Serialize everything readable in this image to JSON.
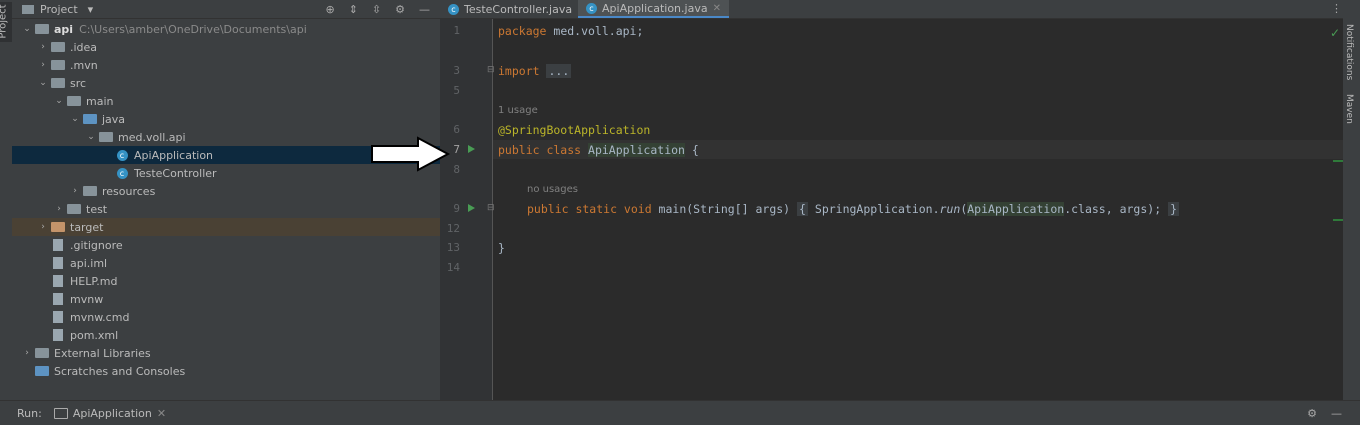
{
  "sidebar_tabs": {
    "project": "Project",
    "notifications": "Notifications",
    "maven": "Maven"
  },
  "project_panel": {
    "title": "Project",
    "tree": [
      {
        "label": "api",
        "path": "C:\\Users\\amber\\OneDrive\\Documents\\api",
        "depth": 0,
        "expanded": true,
        "icon": "folder"
      },
      {
        "label": ".idea",
        "depth": 1,
        "expanded": false,
        "icon": "folder"
      },
      {
        "label": ".mvn",
        "depth": 1,
        "expanded": false,
        "icon": "folder"
      },
      {
        "label": "src",
        "depth": 1,
        "expanded": true,
        "icon": "folder"
      },
      {
        "label": "main",
        "depth": 2,
        "expanded": true,
        "icon": "folder"
      },
      {
        "label": "java",
        "depth": 3,
        "expanded": true,
        "icon": "folder-blue"
      },
      {
        "label": "med.voll.api",
        "depth": 4,
        "expanded": true,
        "icon": "package"
      },
      {
        "label": "ApiApplication",
        "depth": 5,
        "icon": "java-class",
        "selected": true
      },
      {
        "label": "TesteController",
        "depth": 5,
        "icon": "java-class"
      },
      {
        "label": "resources",
        "depth": 3,
        "expanded": false,
        "icon": "folder"
      },
      {
        "label": "test",
        "depth": 2,
        "expanded": false,
        "icon": "folder"
      },
      {
        "label": "target",
        "depth": 1,
        "expanded": false,
        "icon": "folder-orange",
        "excluded": true
      },
      {
        "label": ".gitignore",
        "depth": 1,
        "icon": "file"
      },
      {
        "label": "api.iml",
        "depth": 1,
        "icon": "file"
      },
      {
        "label": "HELP.md",
        "depth": 1,
        "icon": "file"
      },
      {
        "label": "mvnw",
        "depth": 1,
        "icon": "file"
      },
      {
        "label": "mvnw.cmd",
        "depth": 1,
        "icon": "file"
      },
      {
        "label": "pom.xml",
        "depth": 1,
        "icon": "maven-file"
      },
      {
        "label": "External Libraries",
        "depth": 0,
        "expanded": false,
        "icon": "libraries"
      },
      {
        "label": "Scratches and Consoles",
        "depth": 0,
        "icon": "scratches"
      }
    ]
  },
  "editor_tabs": [
    {
      "label": "TesteController.java",
      "active": false
    },
    {
      "label": "ApiApplication.java",
      "active": true
    }
  ],
  "gutter": {
    "line_numbers": [
      "1",
      "3",
      "5",
      "6",
      "7",
      "8",
      "9",
      "12",
      "13",
      "14"
    ]
  },
  "code": {
    "package_kw": "package",
    "package_rest": " med.voll.api;",
    "import_kw": "import",
    "import_fold": "...",
    "usage_hint": "1 usage",
    "annotation": "@SpringBootApplication",
    "class_kw": "public class",
    "class_name": "ApiApplication",
    "class_brace": " {",
    "no_usages": "no usages",
    "main_kw": "public static void",
    "main_sig": " main(String[] args) ",
    "main_body_open": "{",
    "main_call": " SpringApplication.",
    "main_run": "run",
    "main_arg_class": "ApiApplication",
    "main_arg_rest": ".class, args);",
    "main_body_close": "}",
    "closing_brace": "}"
  },
  "run_bar": {
    "label": "Run:",
    "config": "ApiApplication"
  }
}
